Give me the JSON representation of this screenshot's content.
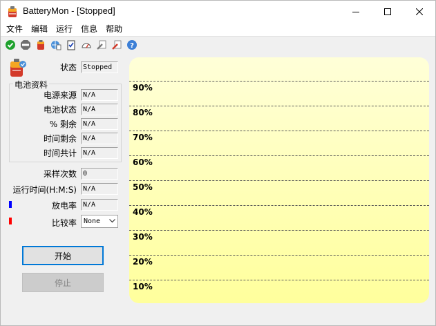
{
  "window": {
    "title": "BatteryMon - [Stopped]"
  },
  "menu": {
    "items": [
      {
        "label": "文件"
      },
      {
        "label": "编辑"
      },
      {
        "label": "运行"
      },
      {
        "label": "信息"
      },
      {
        "label": "帮助"
      }
    ]
  },
  "toolbar": {
    "icons": [
      "check-icon",
      "stop-icon",
      "battery-icon",
      "globe-info-icon",
      "clipboard-icon",
      "gauge-icon",
      "wrench-icon",
      "tools-icon",
      "help-icon"
    ]
  },
  "status": {
    "label": "状态",
    "value": "Stopped"
  },
  "battery_info": {
    "group_title": "电池资料",
    "power_source": {
      "label": "电源来源",
      "value": "N/A"
    },
    "battery_status": {
      "label": "电池状态",
      "value": "N/A"
    },
    "percent_remaining": {
      "label": "% 剩余",
      "value": "N/A"
    },
    "time_remaining": {
      "label": "时间剩余",
      "value": "N/A"
    },
    "time_total": {
      "label": "时间共计",
      "value": "N/A"
    }
  },
  "sampling": {
    "sample_count": {
      "label": "采样次数",
      "value": "0"
    },
    "run_time": {
      "label": "运行时间(H:M:S)",
      "value": "N/A"
    },
    "discharge_rate": {
      "label": "放电率",
      "value": "N/A",
      "color": "#0000ff"
    },
    "compare_rate": {
      "label": "比较率",
      "value": "None",
      "color": "#ff0000"
    }
  },
  "buttons": {
    "start": "开始",
    "stop": "停止"
  },
  "graph": {
    "gridlines": [
      "90%",
      "80%",
      "70%",
      "60%",
      "50%",
      "40%",
      "30%",
      "20%",
      "10%"
    ]
  },
  "colors": {
    "accent": "#0078d7",
    "graph_top": "#ffffd8",
    "graph_bottom": "#ffff9c"
  }
}
